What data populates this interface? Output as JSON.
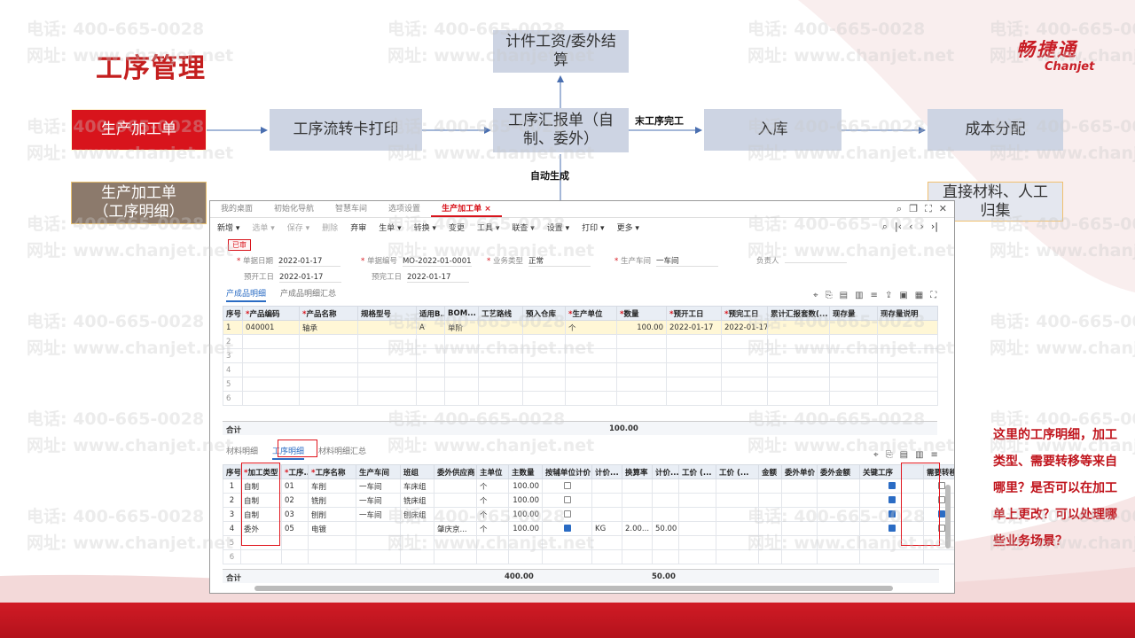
{
  "slide": {
    "title": "工序管理",
    "logo_cn": "畅捷通",
    "logo_en": "Chanjet",
    "watermark_phone": "电话: 400-665-0028",
    "watermark_url": "网址: www.chanjet.net"
  },
  "flow": {
    "box_production_order": "生产加工单",
    "box_production_order_detail": "生产加工单\n（工序明细）",
    "box_route_card": "工序流转卡打印",
    "box_report": "工序汇报单（自制、委外）",
    "box_piecework": "计件工资/委外结算",
    "box_warehouse": "入库",
    "box_cost": "成本分配",
    "box_material": "直接材料、人工归集",
    "label_last_process": "末工序完工",
    "label_auto": "自动生成"
  },
  "app": {
    "tabs": [
      {
        "label": "我的桌面"
      },
      {
        "label": "初始化导航"
      },
      {
        "label": "智慧车间"
      },
      {
        "label": "选项设置"
      },
      {
        "label": "生产加工单"
      }
    ],
    "toolbar": [
      "新增 ▾",
      "选单 ▾",
      "保存 ▾",
      "删除",
      "弃审",
      "生单 ▾",
      "转换 ▾",
      "变更",
      "工具 ▾",
      "联查 ▾",
      "设置 ▾",
      "打印 ▾",
      "更多 ▾"
    ],
    "status": "已审",
    "fields": {
      "doc_date_label": "单据日期",
      "doc_date": "2022-01-17",
      "doc_no_label": "单据编号",
      "doc_no": "MO-2022-01-0001",
      "biz_type_label": "业务类型",
      "biz_type": "正常",
      "workshop_label": "生产车间",
      "workshop": "一车间",
      "owner_label": "负责人",
      "owner": "",
      "plan_start_label": "预开工日",
      "plan_start": "2022-01-17",
      "plan_finish_label": "预完工日",
      "plan_finish": "2022-01-17"
    },
    "product_tabs": [
      "产成品明细",
      "产成品明细汇总"
    ],
    "product_headers": [
      "序号",
      "产品编码",
      "产品名称",
      "规格型号",
      "适用B...",
      "BOM...",
      "工艺路线",
      "预入仓库",
      "生产单位",
      "数量",
      "预开工日",
      "预完工日",
      "累计汇报套数(...",
      "现存量",
      "现存量说明"
    ],
    "product_rows": [
      [
        "1",
        "040001",
        "轴承",
        "",
        "A",
        "单阶",
        "",
        "",
        "个",
        "100.00",
        "2022-01-17",
        "2022-01-17",
        "",
        "",
        ""
      ]
    ],
    "product_total_label": "合计",
    "product_total_qty": "100.00",
    "process_tabs": [
      "材料明细",
      "工序明细",
      "材料明细汇总"
    ],
    "process_headers": [
      "序号",
      "加工类型",
      "工序...",
      "工序名称",
      "生产车间",
      "班组",
      "委外供应商",
      "主单位",
      "主数量",
      "按辅单位计价",
      "计价...",
      "换算率",
      "计价...",
      "工价 (...",
      "工价 (...",
      "金额",
      "委外单价",
      "委外金额",
      "关键工序",
      "需要转移"
    ],
    "process_rows": [
      {
        "no": "1",
        "type": "自制",
        "code": "01",
        "name": "车削",
        "workshop": "一车间",
        "team": "车床组",
        "supplier": "",
        "unit": "个",
        "qty": "100.00",
        "aux": false,
        "pu": "",
        "rate": "",
        "pq": "",
        "key": true,
        "transfer": false
      },
      {
        "no": "2",
        "type": "自制",
        "code": "02",
        "name": "铣削",
        "workshop": "一车间",
        "team": "铣床组",
        "supplier": "",
        "unit": "个",
        "qty": "100.00",
        "aux": false,
        "pu": "",
        "rate": "",
        "pq": "",
        "key": true,
        "transfer": false
      },
      {
        "no": "3",
        "type": "自制",
        "code": "03",
        "name": "刨削",
        "workshop": "一车间",
        "team": "刨床组",
        "supplier": "",
        "unit": "个",
        "qty": "100.00",
        "aux": false,
        "pu": "",
        "rate": "",
        "pq": "",
        "key": true,
        "transfer": true
      },
      {
        "no": "4",
        "type": "委外",
        "code": "05",
        "name": "电镀",
        "workshop": "",
        "team": "",
        "supplier": "肇庆京...",
        "unit": "个",
        "qty": "100.00",
        "aux": true,
        "pu": "KG",
        "rate": "2.00...",
        "pq": "50.00",
        "key": true,
        "transfer": false
      }
    ],
    "process_total_label": "合计",
    "process_total_qty": "400.00",
    "process_total_pq": "50.00"
  },
  "note": "这里的工序明细，加工类型、需要转移等来自哪里？是否可以在加工单上更改？可以处理哪些业务场景？"
}
